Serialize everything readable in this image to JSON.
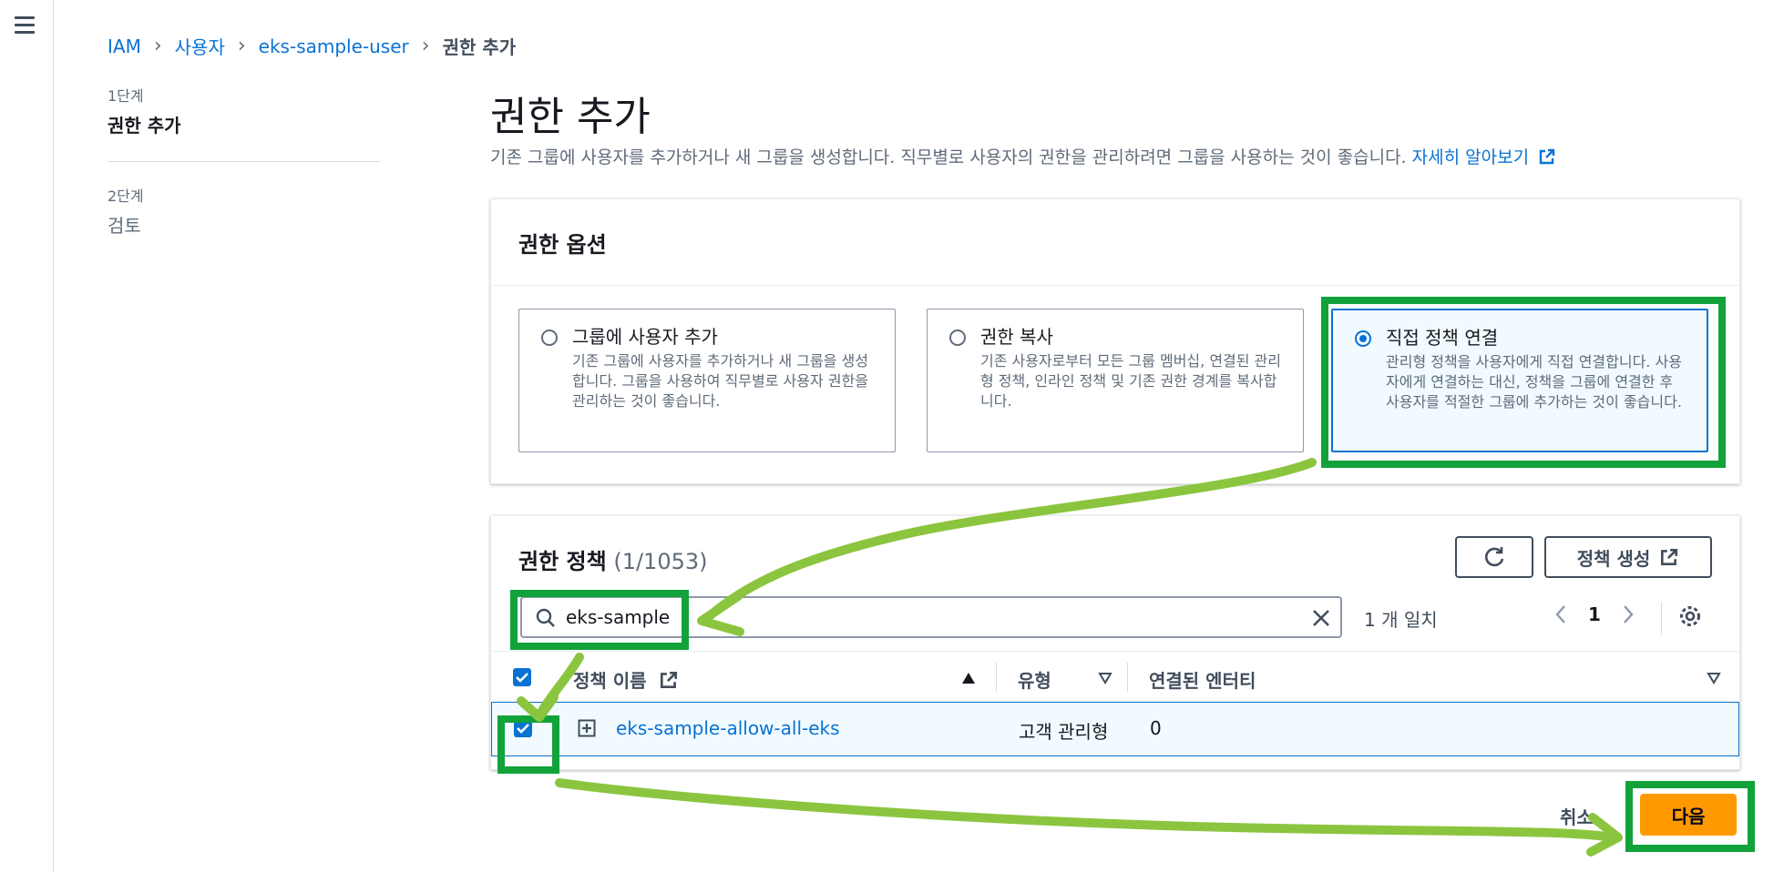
{
  "breadcrumb": {
    "items": [
      "IAM",
      "사용자",
      "eks-sample-user"
    ],
    "current": "권한 추가"
  },
  "steps": [
    {
      "num": "1단계",
      "title": "권한 추가"
    },
    {
      "num": "2단계",
      "title": "검토"
    }
  ],
  "page": {
    "title": "권한 추가",
    "description": "기존 그룹에 사용자를 추가하거나 새 그룹을 생성합니다. 직무별로 사용자의 권한을 관리하려면 그룹을 사용하는 것이 좋습니다.",
    "learn_more": "자세히 알아보기"
  },
  "options": {
    "header": "권한 옵션",
    "cards": [
      {
        "title": "그룹에 사용자 추가",
        "desc": "기존 그룹에 사용자를 추가하거나 새 그룹을 생성합니다. 그룹을 사용하여 직무별로 사용자 권한을 관리하는 것이 좋습니다.",
        "selected": false
      },
      {
        "title": "권한 복사",
        "desc": "기존 사용자로부터 모든 그룹 멤버십, 연결된 관리형 정책, 인라인 정책 및 기존 권한 경계를 복사합니다.",
        "selected": false
      },
      {
        "title": "직접 정책 연결",
        "desc": "관리형 정책을 사용자에게 직접 연결합니다. 사용자에게 연결하는 대신, 정책을 그룹에 연결한 후 사용자를 적절한 그룹에 추가하는 것이 좋습니다.",
        "selected": true
      }
    ]
  },
  "policies": {
    "title": "권한 정책",
    "count": "(1/1053)",
    "create_label": "정책 생성",
    "search_value": "eks-sample",
    "match_text": "1 개 일치",
    "page": "1",
    "columns": [
      "정책 이름",
      "유형",
      "연결된 엔터티"
    ],
    "rows": [
      {
        "name": "eks-sample-allow-all-eks",
        "type": "고객 관리형",
        "entities": "0"
      }
    ]
  },
  "actions": {
    "cancel": "취소",
    "next": "다음"
  },
  "colors": {
    "link": "#0972d3",
    "primary": "#ff9900",
    "annotation": "#12a23a",
    "arrow": "#8bc53f"
  }
}
